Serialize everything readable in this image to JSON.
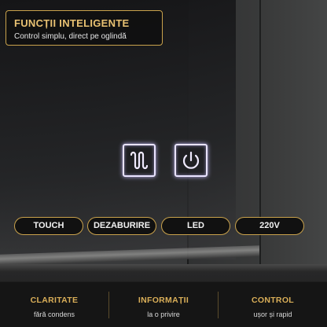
{
  "header": {
    "title": "FUNCȚII INTELIGENTE",
    "subtitle": "Control simplu, direct pe oglindă"
  },
  "touch_controls": [
    {
      "icon": "defog-icon"
    },
    {
      "icon": "power-icon"
    }
  ],
  "features": [
    {
      "label": "TOUCH"
    },
    {
      "label": "DEZABURIRE"
    },
    {
      "label": "LED"
    },
    {
      "label": "220V"
    }
  ],
  "info": [
    {
      "title": "CLARITATE",
      "subtitle": "fără condens"
    },
    {
      "title": "INFORMAȚII",
      "subtitle": "la o privire"
    },
    {
      "title": "CONTROL",
      "subtitle": "ușor și rapid"
    }
  ],
  "colors": {
    "accent_gold": "#c9a24c",
    "title_gold": "#e8c172",
    "icon_glow": "#e9e3ff",
    "background": "#151515"
  }
}
